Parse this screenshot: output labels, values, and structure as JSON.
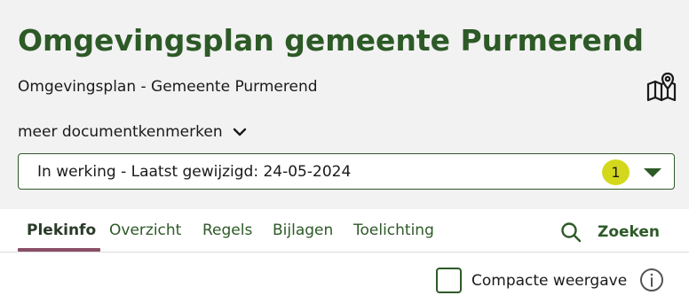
{
  "header": {
    "title": "Omgevingsplan gemeente Purmerend",
    "subtitle": "Omgevingsplan - Gemeente Purmerend",
    "map_icon": "map-pin-icon",
    "meta_toggle_label": "meer documentkenmerken",
    "meta_toggle_icon": "chevron-down-icon",
    "status_select": {
      "value": "In werking - Laatst gewijzigd: 24-05-2024",
      "badge_count": "1",
      "caret_icon": "caret-down-icon"
    }
  },
  "tabs": [
    {
      "label": "Plekinfo",
      "active": true
    },
    {
      "label": "Overzicht",
      "active": false
    },
    {
      "label": "Regels",
      "active": false
    },
    {
      "label": "Bijlagen",
      "active": false
    },
    {
      "label": "Toelichting",
      "active": false
    }
  ],
  "search": {
    "label": "Zoeken",
    "icon": "search-icon"
  },
  "compact_view": {
    "label": "Compacte weergave",
    "checked": false,
    "info_icon": "info-icon"
  },
  "colors": {
    "brand_green": "#2d5a27",
    "header_bg": "#f2f2f2",
    "badge_yellow": "#d4d81c",
    "tab_underline": "#8a4f66"
  }
}
